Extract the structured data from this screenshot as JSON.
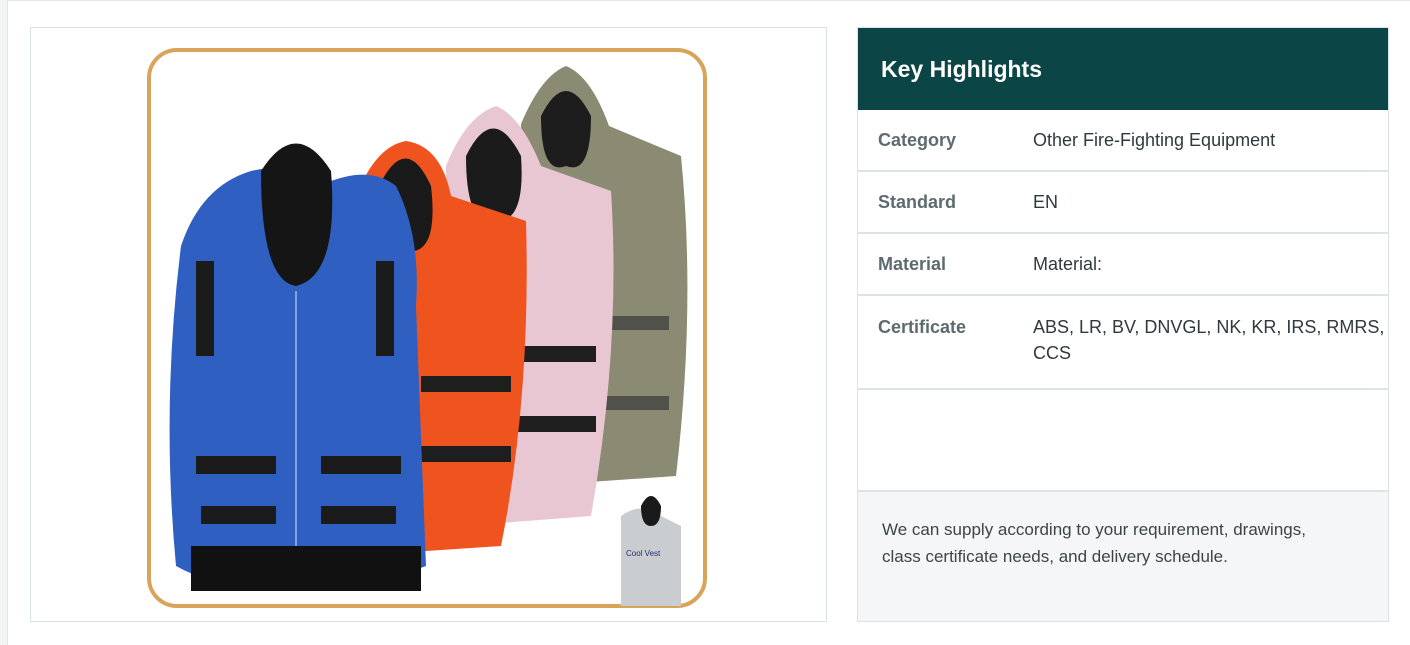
{
  "product": {
    "image_alt": "Cool vest set in blue, orange, pink and olive",
    "inset_text": "Cool Vest"
  },
  "highlights": {
    "title": "Key Highlights",
    "rows": [
      {
        "key": "Category",
        "value": "Other Fire-Fighting Equipment"
      },
      {
        "key": "Standard",
        "value": "EN"
      },
      {
        "key": "Material",
        "value": "Material:"
      },
      {
        "key": "Certificate",
        "value": "ABS, LR, BV, DNVGL, NK, KR, IRS, RMRS, CCS"
      }
    ],
    "note": "We can supply according to your requirement, drawings, class certificate needs, and delivery schedule."
  },
  "colors": {
    "header": "#0b4546",
    "vest_blue": "#2f5fc0",
    "vest_orange": "#f0541e",
    "vest_pink": "#e8c7d3",
    "vest_olive": "#8b8a73"
  }
}
